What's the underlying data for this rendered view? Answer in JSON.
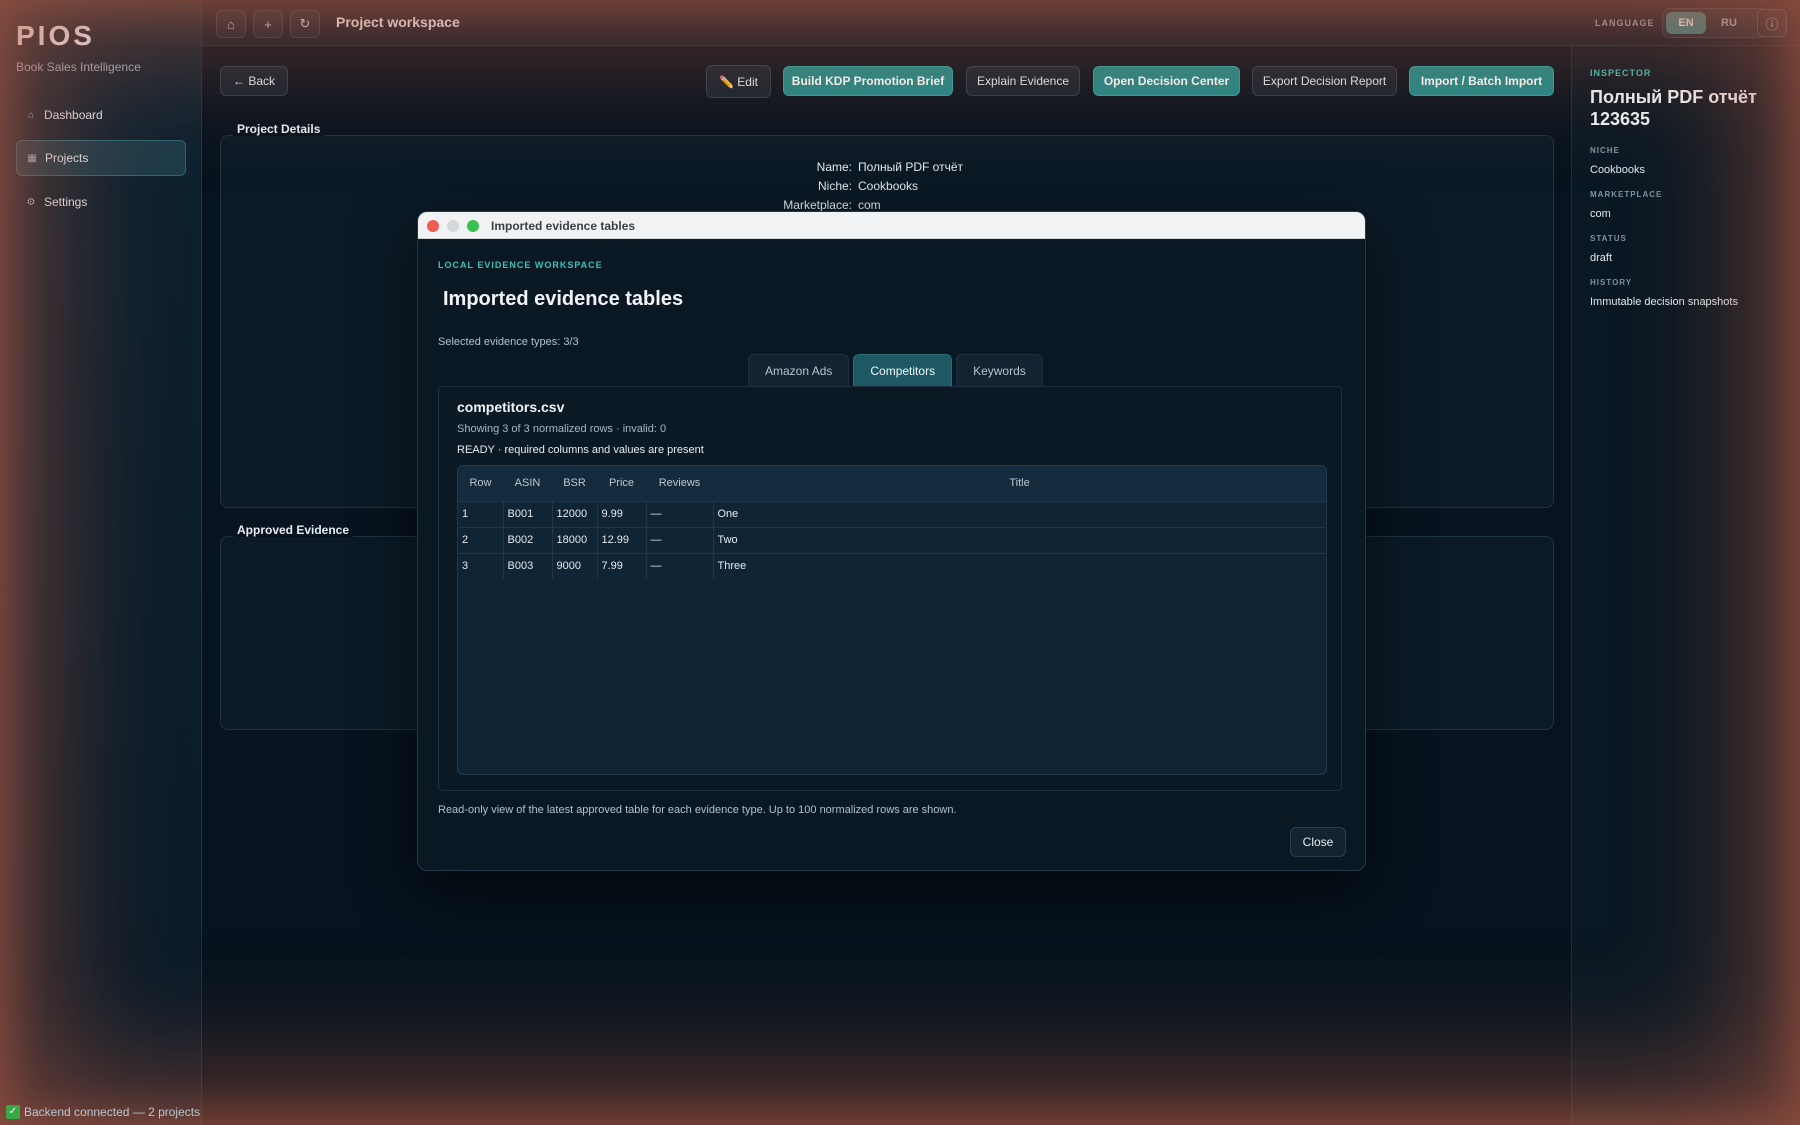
{
  "app": {
    "brand": "PIOS",
    "brand_subtitle": "Book Sales Intelligence",
    "status": "Backend connected — 2 projects"
  },
  "sidebar": {
    "items": [
      {
        "label": "Dashboard",
        "icon": "home-icon",
        "active": false
      },
      {
        "label": "Projects",
        "icon": "square-icon",
        "active": true
      },
      {
        "label": "Settings",
        "icon": "gear-icon",
        "active": false
      }
    ]
  },
  "topbar": {
    "title": "Project workspace",
    "home_glyph": "⌂",
    "add_glyph": "+",
    "refresh_glyph": "↻",
    "language_label": "LANGUAGE",
    "lang_en": "EN",
    "lang_ru": "RU",
    "info_glyph": "ⓘ"
  },
  "toolbar": {
    "back": "← Back",
    "edit": "✏️ Edit",
    "build_brief": "Build KDP Promotion Brief",
    "explain": "Explain Evidence",
    "decision_center": "Open Decision Center",
    "export_report": "Export Decision Report",
    "import": "Import / Batch Import"
  },
  "project_details": {
    "title": "Project Details",
    "name_label": "Name:",
    "name": "Полный PDF отчёт",
    "niche_label": "Niche:",
    "niche": "Cookbooks",
    "marketplace_label": "Marketplace:",
    "marketplace": "com"
  },
  "approved_evidence": {
    "title": "Approved Evidence"
  },
  "inspector": {
    "heading": "INSPECTOR",
    "title": "Полный PDF отчёт 123635",
    "fields": [
      {
        "label": "NICHE",
        "value": "Cookbooks"
      },
      {
        "label": "MARKETPLACE",
        "value": "com"
      },
      {
        "label": "STATUS",
        "value": "draft"
      },
      {
        "label": "HISTORY",
        "value": "Immutable decision snapshots"
      }
    ]
  },
  "modal": {
    "window_title": "Imported evidence tables",
    "overline": "LOCAL EVIDENCE WORKSPACE",
    "heading": "Imported evidence tables",
    "selected_types": "Selected evidence types: 3/3",
    "tabs": [
      "Amazon Ads",
      "Competitors",
      "Keywords"
    ],
    "active_tab": "Competitors",
    "file": {
      "name": "competitors.csv",
      "rows_info": "Showing 3 of 3 normalized rows · invalid: 0",
      "ready": "READY · required columns and values are present"
    },
    "table": {
      "columns": [
        "Row",
        "ASIN",
        "BSR",
        "Price",
        "Reviews",
        "Title"
      ],
      "rows": [
        [
          "1",
          "B001",
          "12000",
          "9.99",
          "—",
          "One"
        ],
        [
          "2",
          "B002",
          "18000",
          "12.99",
          "—",
          "Two"
        ],
        [
          "3",
          "B003",
          "9000",
          "7.99",
          "—",
          "Three"
        ]
      ]
    },
    "footnote": "Read-only view of the latest approved table for each evidence type. Up to 100 normalized rows are shown.",
    "close": "Close"
  }
}
